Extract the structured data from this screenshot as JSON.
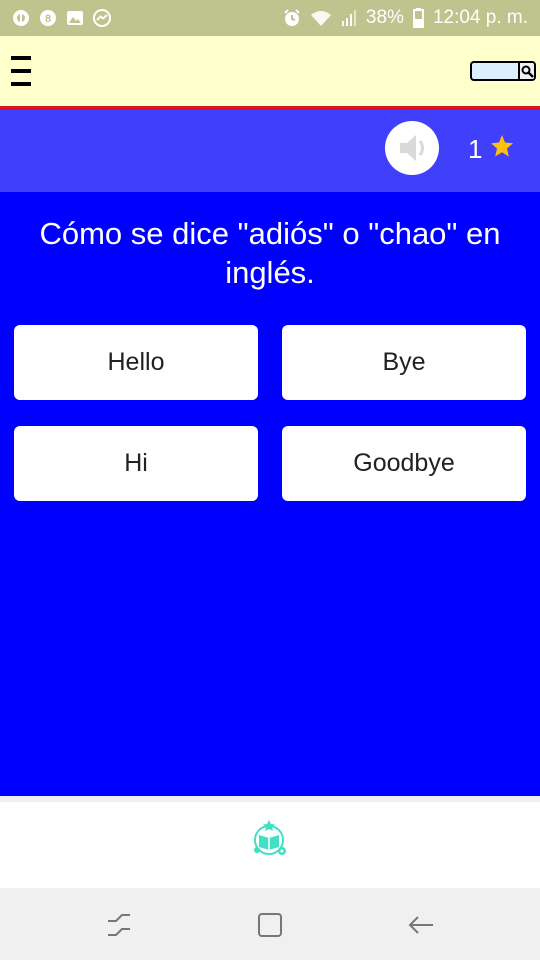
{
  "status_bar": {
    "battery_percent": "38%",
    "time": "12:04 p. m."
  },
  "quiz": {
    "score": "1",
    "question": "Cómo se dice \"adiós\" o \"chao\" en inglés.",
    "answers": [
      "Hello",
      "Bye",
      "Hi",
      "Goodbye"
    ]
  },
  "colors": {
    "status_bar": "#bfc48f",
    "top_bar": "#ffffcc",
    "accent_line": "#d9161f",
    "header_band": "#3f3ffc",
    "main_bg": "#0000ff",
    "star": "#ffc107",
    "app_logo": "#3fe0c5"
  },
  "icons": {
    "status_left": [
      "vpn-icon",
      "notification-8-icon",
      "image-icon",
      "messenger-icon"
    ],
    "status_right": [
      "alarm-icon",
      "wifi-icon",
      "signal-icon",
      "battery-icon"
    ],
    "top_bar": [
      "menu-icon",
      "search-icon"
    ],
    "header": [
      "speaker-icon",
      "star-icon"
    ],
    "bottom": [
      "app-logo-icon"
    ],
    "nav": [
      "recent-apps-icon",
      "home-icon",
      "back-icon"
    ]
  }
}
